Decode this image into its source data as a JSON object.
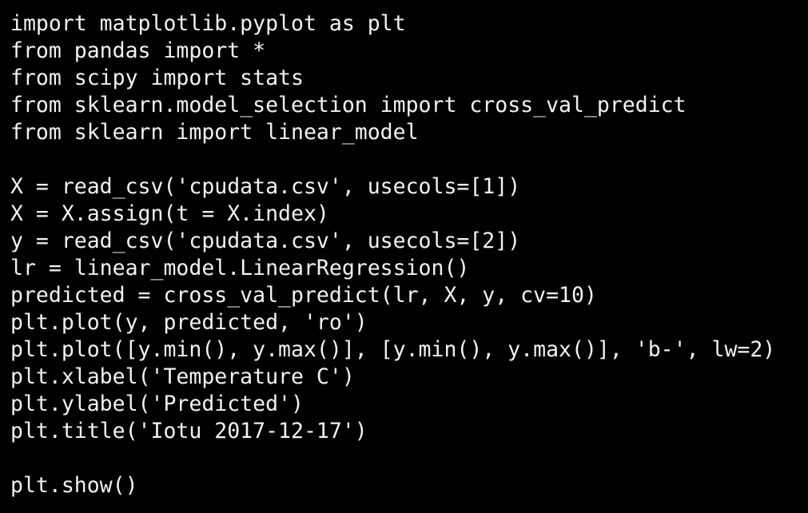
{
  "editor": {
    "background": "#000000",
    "text_color": "#f2f2f2",
    "lines": [
      "import matplotlib.pyplot as plt",
      "from pandas import *",
      "from scipy import stats",
      "from sklearn.model_selection import cross_val_predict",
      "from sklearn import linear_model",
      "",
      "X = read_csv('cpudata.csv', usecols=[1])",
      "X = X.assign(t = X.index)",
      "y = read_csv('cpudata.csv', usecols=[2])",
      "lr = linear_model.LinearRegression()",
      "predicted = cross_val_predict(lr, X, y, cv=10)",
      "plt.plot(y, predicted, 'ro')",
      "plt.plot([y.min(), y.max()], [y.min(), y.max()], 'b-', lw=2)",
      "plt.xlabel('Temperature C')",
      "plt.ylabel('Predicted')",
      "plt.title('Iotu 2017-12-17')",
      "",
      "plt.show()"
    ]
  }
}
